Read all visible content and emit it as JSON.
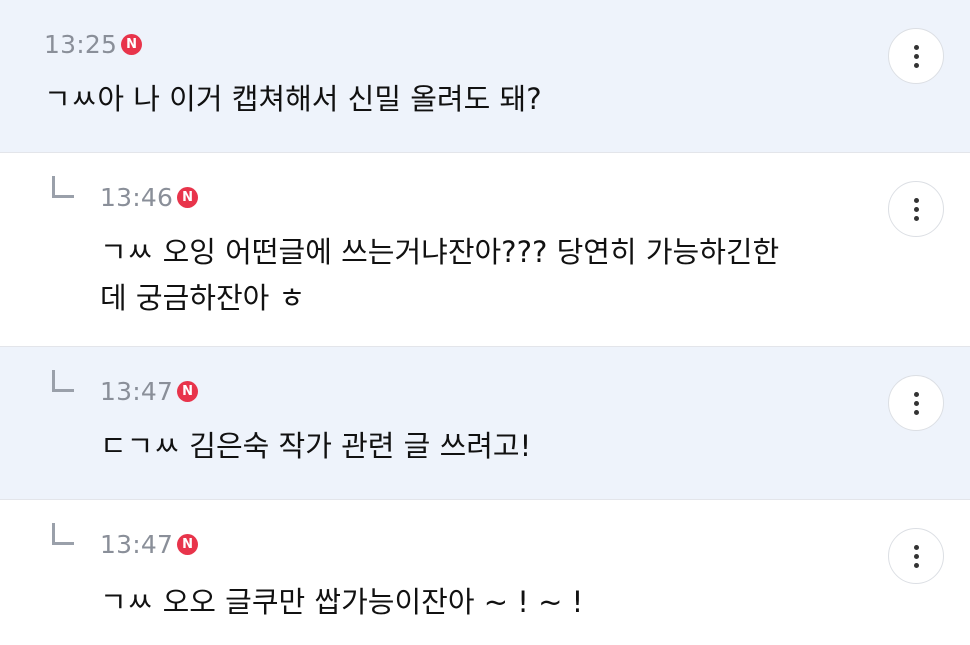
{
  "comments": [
    {
      "time": "13:25",
      "badge": "N",
      "text": "ㄱㅆ아 나 이거 캡쳐해서 신밀 올려도 돼?",
      "more_icon": "more-vertical-icon"
    },
    {
      "time": "13:46",
      "badge": "N",
      "text_line1": "ㄱㅆ 오잉 어떤글에 쓰는거냐잔아??? 당연히 가능하긴한",
      "text_line2": "데 궁금하잔아 ㅎ",
      "reply_icon": "reply-arrow-icon",
      "more_icon": "more-vertical-icon"
    },
    {
      "time": "13:47",
      "badge": "N",
      "text": "ㄷㄱㅆ 김은숙 작가 관련 글 쓰려고!",
      "reply_icon": "reply-arrow-icon",
      "more_icon": "more-vertical-icon"
    },
    {
      "time": "13:47",
      "badge": "N",
      "text": "ㄱㅆ 오오 글쿠만 쌉가능이잔아 ~ ! ~ !",
      "reply_icon": "reply-arrow-icon",
      "more_icon": "more-vertical-icon"
    }
  ],
  "colors": {
    "highlight_bg": "#eef3fb",
    "badge": "#e8344b",
    "time": "#8a8f99"
  }
}
